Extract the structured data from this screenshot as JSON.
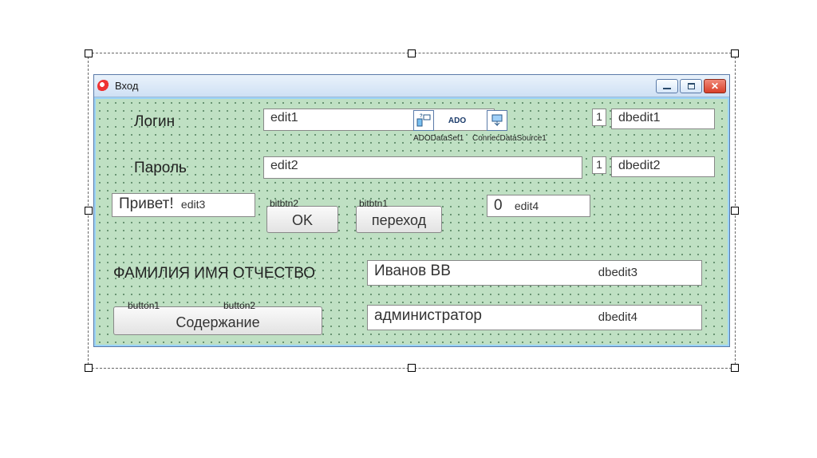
{
  "window": {
    "title": "Вход"
  },
  "labels": {
    "login": "Логин",
    "password": "Пароль",
    "greeting": "Привет!",
    "fio": "ФАМИЛИЯ ИМЯ ОТЧЕСТВО"
  },
  "edits": {
    "edit1_name": "edit1",
    "edit2_name": "edit2",
    "edit3_name": "edit3",
    "edit4_name": "edit4",
    "edit4_value": "0",
    "dbedit1_name": "dbedit1",
    "dbedit1_value": "1",
    "dbedit2_name": "dbedit2",
    "dbedit2_value": "1",
    "dbedit3_name": "dbedit3",
    "dbedit3_value": "Иванов ВВ",
    "dbedit4_name": "dbedit4",
    "dbedit4_value": "администратор"
  },
  "buttons": {
    "bitbtn2_name": "bitbtn2",
    "bitbtn2_caption": "OK",
    "bitbtn1_name": "bitbtn1",
    "bitbtn1_caption": "переход",
    "button1_name": "button1",
    "button2_name": "button2",
    "button1_caption": "Содержание"
  },
  "components": {
    "adodataset": "ADODataSet1",
    "adoconnection": "ConnecDataSource1",
    "ado_text": "ADO"
  }
}
